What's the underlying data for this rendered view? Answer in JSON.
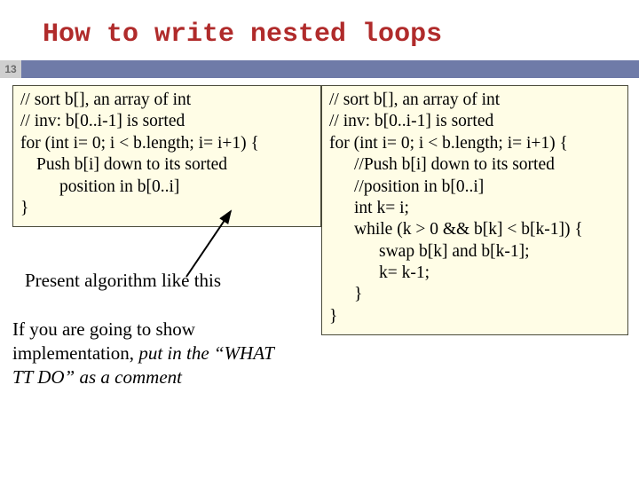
{
  "title": "How to write nested loops",
  "page_number": "13",
  "left_box": {
    "l1": "// sort b[], an array of int",
    "l2": "// inv: b[0..i-1] is sorted",
    "l3": "for (int i= 0; i < b.length; i= i+1) {",
    "l4": "Push b[i] down to its sorted",
    "l5": "position in b[0..i]",
    "l6": "}"
  },
  "right_box": {
    "l1": "// sort b[], an array of int",
    "l2": "// inv: b[0..i-1] is sorted",
    "l3": "for (int i= 0; i < b.length; i= i+1) {",
    "l4": "//Push b[i] down to its sorted",
    "l5": "//position in b[0..i]",
    "l6": "int k= i;",
    "l7": "while (k > 0  &&  b[k] < b[k-1]) {",
    "l8": "swap b[k] and b[k-1];",
    "l9": "k= k-1;",
    "l10": "}",
    "l11": "}"
  },
  "caption1": "Present algorithm like this",
  "caption2a": "If you are going to show implementation, ",
  "caption2b": "put in the “WHAT TT DO” as a comment"
}
